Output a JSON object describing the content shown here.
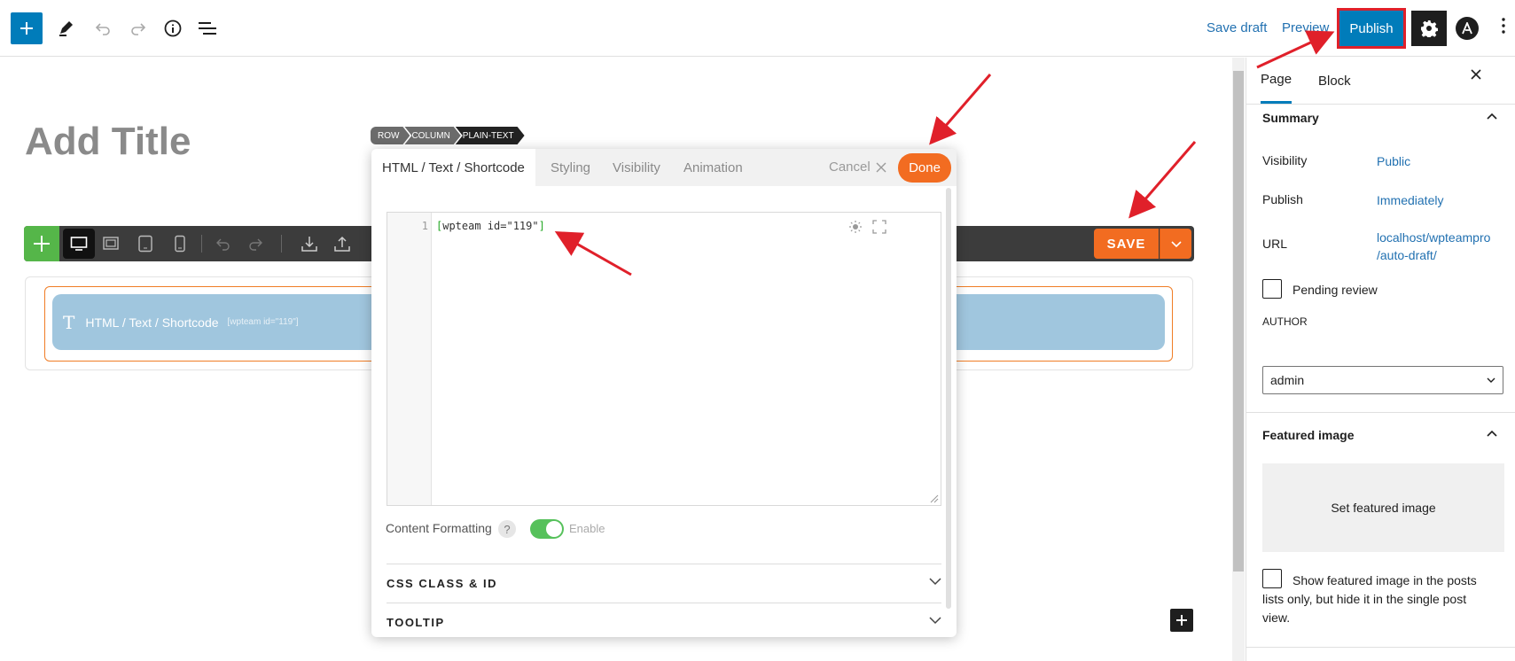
{
  "topbar": {
    "add_icon": "plus-icon",
    "tools_icon": "pencil-icon",
    "undo_icon": "undo-icon",
    "redo_icon": "redo-icon",
    "details_icon": "info-icon",
    "outline_icon": "list-view-icon",
    "save_draft": "Save draft",
    "preview": "Preview",
    "publish": "Publish",
    "settings_icon": "gear-icon",
    "astra_icon": "astra-logo-icon",
    "more_icon": "kebab-icon"
  },
  "editor": {
    "title_placeholder": "Add Title",
    "breadcrumbs": [
      "ROW",
      "COLUMN",
      "PLAIN-TEXT"
    ],
    "element_label": "HTML / Text / Shortcode",
    "element_shortcode": "[wpteam id=\"119\"]",
    "save": "SAVE"
  },
  "modal": {
    "tabs": [
      "HTML / Text / Shortcode",
      "Styling",
      "Visibility",
      "Animation"
    ],
    "cancel": "Cancel",
    "done": "Done",
    "line_number": "1",
    "code_open": "[",
    "code_body": "wpteam id=\"119\"",
    "code_close": "]",
    "content_formatting": "Content Formatting",
    "help": "?",
    "enable": "Enable",
    "sections": [
      "CSS CLASS & ID",
      "TOOLTIP"
    ]
  },
  "sidebar": {
    "tabs": [
      "Page",
      "Block"
    ],
    "summary": "Summary",
    "visibility_label": "Visibility",
    "visibility_value": "Public",
    "publish_label": "Publish",
    "publish_value": "Immediately",
    "url_label": "URL",
    "url_line1": "localhost/wpteampro",
    "url_line2": "/auto-draft/",
    "pending_review": "Pending review",
    "author_label": "AUTHOR",
    "author_value": "admin",
    "featured_image": "Featured image",
    "set_featured": "Set featured image",
    "show_featured_line1": "Show featured image in the posts",
    "show_featured_line2": "lists only, but hide it in the single post",
    "show_featured_line3": "view."
  },
  "colors": {
    "wp_blue": "#007cba",
    "accent_orange": "#f26c21",
    "annotation_red": "#e0202a",
    "element_blue": "#a0c6de",
    "builder_green": "#55b649"
  }
}
